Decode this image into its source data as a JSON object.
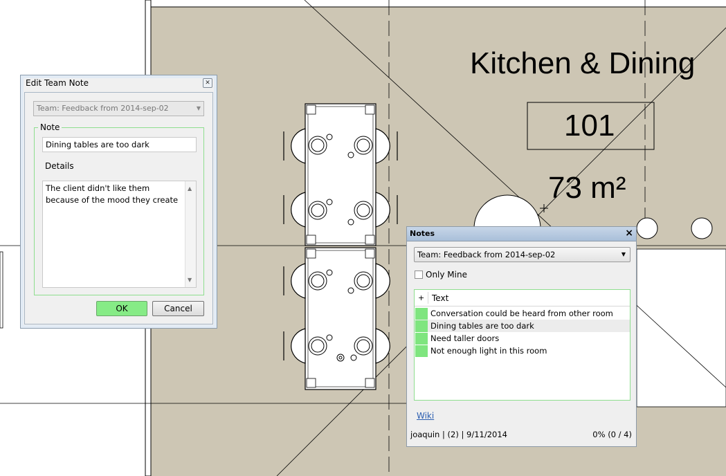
{
  "plan": {
    "room_name": "Kitchen & Dining",
    "room_number": "101",
    "room_area": "73 m²",
    "colors": {
      "floor": "#cdc6b4",
      "walls": "#000000",
      "background": "#ffffff"
    }
  },
  "edit_dialog": {
    "title": "Edit Team Note",
    "team_select": "Team: Feedback from 2014-sep-02",
    "note_legend": "Note",
    "note_value": "Dining tables are too dark",
    "details_label": "Details",
    "details_value": "The client didn't like them because of the mood they create",
    "ok_label": "OK",
    "cancel_label": "Cancel",
    "colors": {
      "ok_button": "#86eb86",
      "group_border": "#8ede8e"
    }
  },
  "notes_panel": {
    "title": "Notes",
    "team_select": "Team: Feedback from 2014-sep-02",
    "only_mine_label": "Only Mine",
    "only_mine_checked": false,
    "grid": {
      "add_col": "+",
      "text_col": "Text",
      "rows": [
        {
          "text": "Conversation could be heard from other room",
          "status_color": "#7fe57f"
        },
        {
          "text": "Dining tables are too dark",
          "status_color": "#7fe57f"
        },
        {
          "text": "Need taller doors",
          "status_color": "#7fe57f"
        },
        {
          "text": "Not enough light in this room",
          "status_color": "#7fe57f"
        }
      ]
    },
    "wiki_label": "Wiki",
    "status_text": "joaquin | (2) | 9/11/2014",
    "progress_text": "0% (0 / 4)"
  }
}
